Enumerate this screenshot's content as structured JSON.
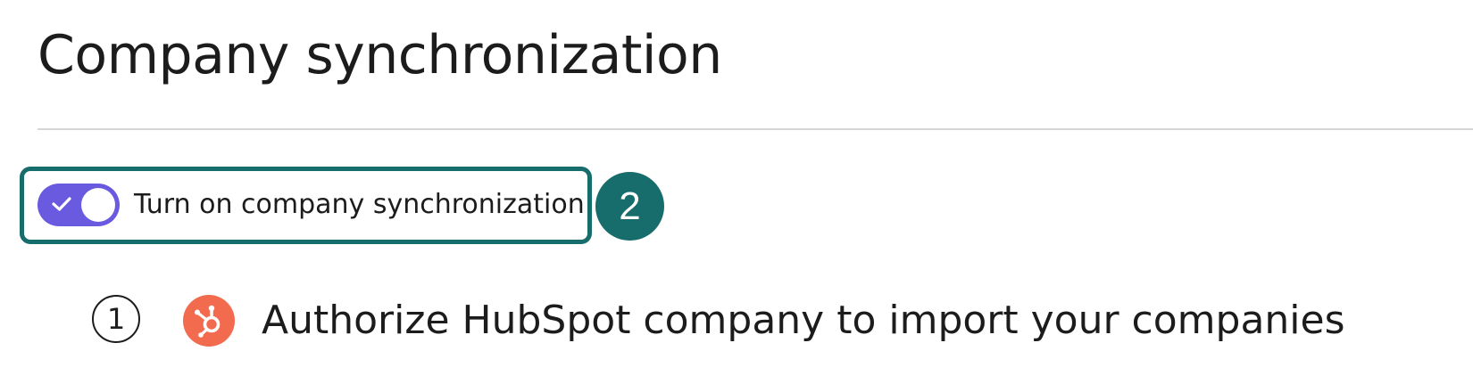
{
  "header": {
    "title": "Company synchronization"
  },
  "sync_toggle": {
    "label": "Turn on company synchronization",
    "checked": true,
    "color": "#6a5ae0"
  },
  "callout": {
    "number": "2",
    "color": "#176c6c"
  },
  "steps": [
    {
      "number": "1",
      "icon": "hubspot-icon",
      "icon_color": "#f26b4e",
      "label": "Authorize HubSpot company to import your companies"
    }
  ]
}
